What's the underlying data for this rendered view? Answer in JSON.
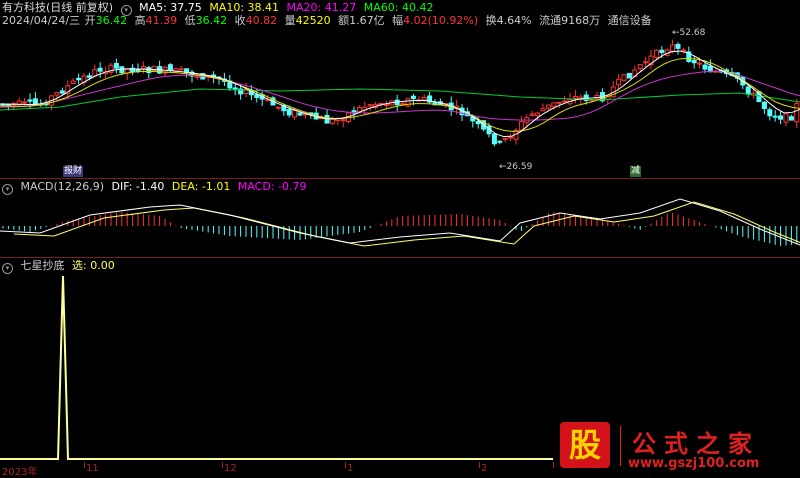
{
  "header": {
    "title": "有方科技(日线 前复权)",
    "ma_labels": [
      {
        "text": "MA5: 37.75",
        "color": "#ffffff"
      },
      {
        "text": "MA10: 38.41",
        "color": "#ffff00"
      },
      {
        "text": "MA20: 41.27",
        "color": "#ff00ff"
      },
      {
        "text": "MA60: 40.42",
        "color": "#00ff00"
      }
    ],
    "quote": {
      "date": "2024/04/24/三",
      "open_label": "开",
      "open": "36.42",
      "high_label": "高",
      "high": "41.39",
      "low_label": "低",
      "low": "36.42",
      "close_label": "收",
      "close": "40.82",
      "vol_label": "量",
      "vol": "42520",
      "amount_label": "额",
      "amount": "1.67亿",
      "change_label": "幅",
      "change": "4.02(10.92%)",
      "turnover": "换4.64%",
      "float": "流通9168万",
      "industry": "通信设备"
    }
  },
  "price_panel": {
    "high_note": "52.68",
    "low_note": "26.59",
    "badge_left": "报财",
    "badge_right": "减"
  },
  "macd_panel": {
    "title": "MACD(12,26,9)",
    "dif": "DIF: -1.40",
    "dea": "DEA: -1.01",
    "macd": "MACD: -0.79"
  },
  "indicator_panel": {
    "title": "七星抄底",
    "value": "选: 0.00"
  },
  "time_axis": {
    "labels": [
      "2023年",
      "11",
      "12",
      "1",
      "2"
    ]
  },
  "watermark": {
    "glyph": "股",
    "title": "公式之家",
    "url": "www.gszj100.com"
  },
  "colors": {
    "up": "#ff3232",
    "down": "#54ffff",
    "ma5": "#ffffff",
    "ma10": "#ffff00",
    "ma20": "#ff00ff",
    "ma60": "#00ff00",
    "divider": "#7a1d1d"
  },
  "chart_data": [
    {
      "type": "candlestick",
      "title": "有方科技(日线 前复权)",
      "series": [
        {
          "name": "MA5"
        },
        {
          "name": "MA10"
        },
        {
          "name": "MA20"
        },
        {
          "name": "MA60"
        }
      ],
      "annotations": [
        "52.68",
        "26.59"
      ]
    },
    {
      "type": "bar",
      "title": "MACD(12,26,9)",
      "series": [
        {
          "name": "DIF"
        },
        {
          "name": "DEA"
        },
        {
          "name": "MACD"
        }
      ]
    },
    {
      "type": "line",
      "title": "七星抄底",
      "series": [
        {
          "name": "选"
        }
      ]
    }
  ]
}
